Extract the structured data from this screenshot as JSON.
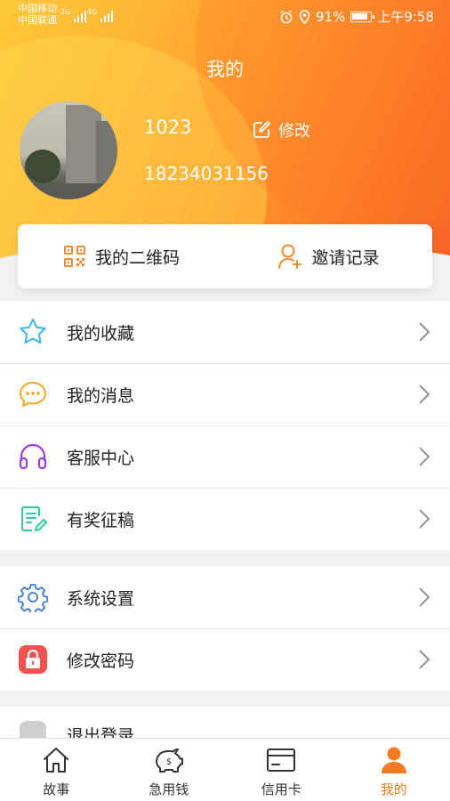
{
  "status_bar": {
    "carrier1": "中国移动",
    "carrier2": "中国联通",
    "net1": "2G",
    "net2": "4G",
    "battery": "91%",
    "time": "上午9:58"
  },
  "header": {
    "title": "我的"
  },
  "profile": {
    "name": "1023",
    "edit_label": "修改",
    "phone": "18234031156"
  },
  "quick": {
    "qr_label": "我的二维码",
    "invite_label": "邀请记录"
  },
  "menu_group1": [
    {
      "label": "我的收藏",
      "icon": "star-icon"
    },
    {
      "label": "我的消息",
      "icon": "message-icon"
    },
    {
      "label": "客服中心",
      "icon": "headset-icon"
    },
    {
      "label": "有奖征稿",
      "icon": "document-edit-icon"
    }
  ],
  "menu_group2": [
    {
      "label": "系统设置",
      "icon": "gear-icon"
    },
    {
      "label": "修改密码",
      "icon": "lock-icon"
    }
  ],
  "logout": {
    "label": "退出登录"
  },
  "tabs": [
    {
      "label": "故事",
      "icon": "home-icon"
    },
    {
      "label": "急用钱",
      "icon": "piggy-bank-icon"
    },
    {
      "label": "信用卡",
      "icon": "credit-card-icon"
    },
    {
      "label": "我的",
      "icon": "user-icon",
      "active": true
    }
  ],
  "colors": {
    "accent": "#f57b20",
    "header_start": "#ffc93a",
    "header_end": "#f76325"
  }
}
